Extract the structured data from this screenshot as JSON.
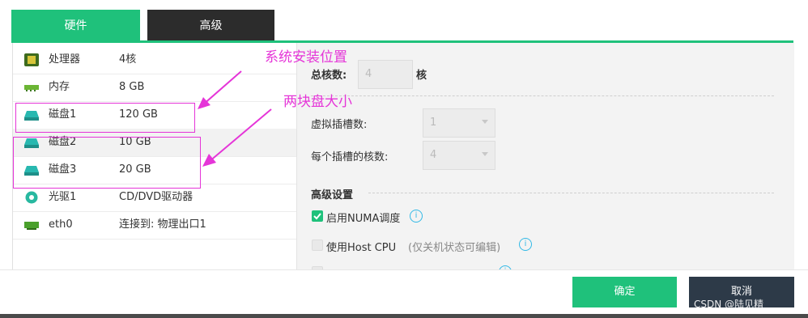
{
  "tabs": {
    "hardware": "硬件",
    "advanced": "高级"
  },
  "devices": [
    {
      "name": "处理器",
      "value": "4核",
      "icon": "cpu-icon"
    },
    {
      "name": "内存",
      "value": "8 GB",
      "icon": "memory-icon"
    },
    {
      "name": "磁盘1",
      "value": "120 GB",
      "icon": "disk-icon"
    },
    {
      "name": "磁盘2",
      "value": "10 GB",
      "icon": "disk-icon"
    },
    {
      "name": "磁盘3",
      "value": "20 GB",
      "icon": "disk-icon"
    },
    {
      "name": "光驱1",
      "value": "CD/DVD驱动器",
      "icon": "cdrom-icon"
    },
    {
      "name": "eth0",
      "value": "连接到: 物理出口1",
      "icon": "network-icon"
    }
  ],
  "cpu": {
    "total_cores_label": "总核数:",
    "total_cores_value": "4",
    "cores_unit": "核",
    "sockets_label": "虚拟插槽数:",
    "sockets_value": "1",
    "cores_per_socket_label": "每个插槽的核数:",
    "cores_per_socket_value": "4"
  },
  "advanced": {
    "section_title": "高级设置",
    "numa_label": "启用NUMA调度",
    "numa_checked": true,
    "host_cpu_label": "使用Host CPU",
    "host_cpu_hint": "(仅关机状态可编辑)",
    "host_cpu_checked": false
  },
  "annotations": {
    "install_location": "系统安装位置",
    "disk_sizes": "两块盘大小"
  },
  "footer": {
    "ok": "确定",
    "cancel": "取消"
  },
  "watermark": "CSDN @陆见精",
  "colors": {
    "accent": "#1fc17b",
    "dark": "#2c2c2c",
    "annotation": "#e535d8",
    "info": "#32b9e6"
  }
}
